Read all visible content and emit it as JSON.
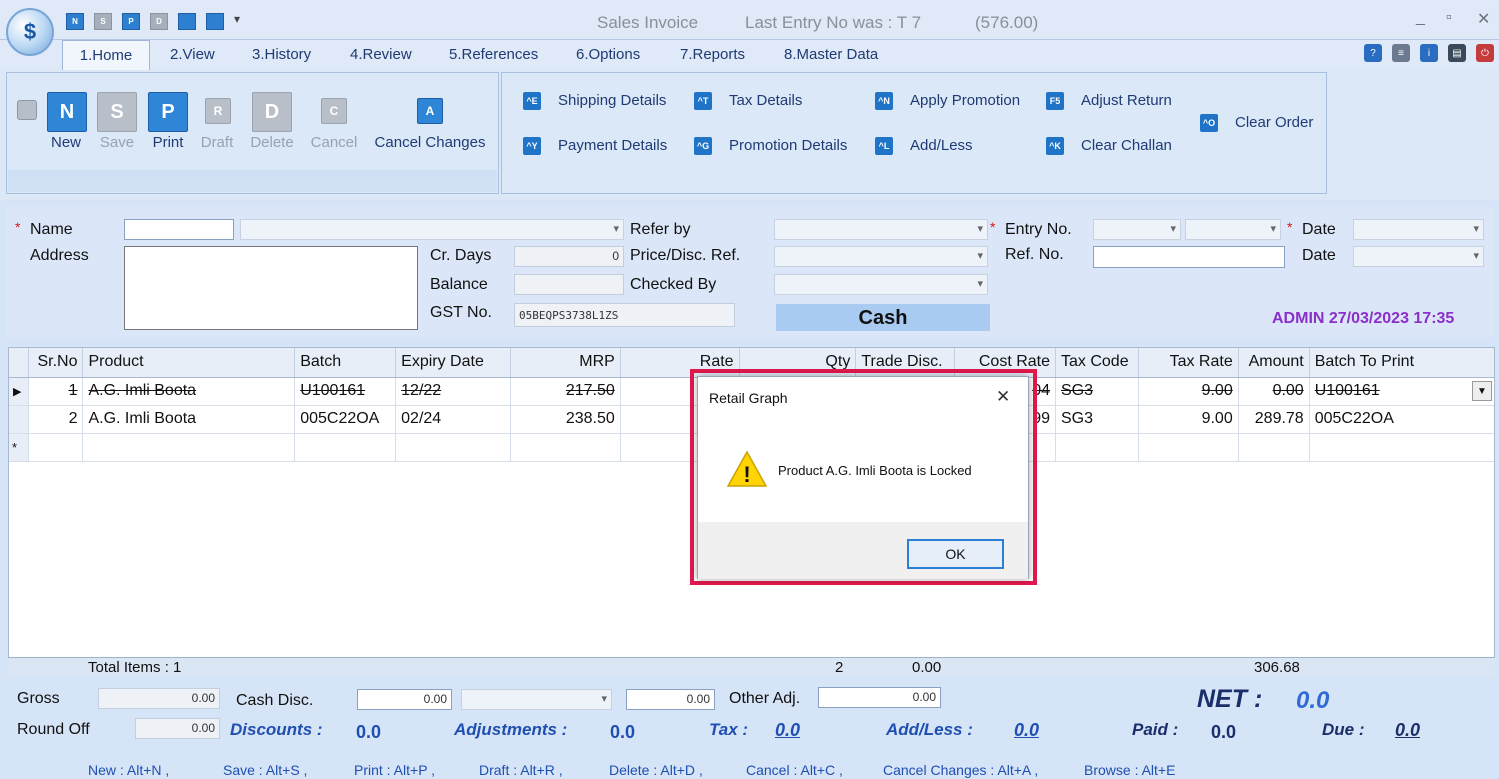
{
  "window": {
    "title": "Sales Invoice",
    "last_entry": "Last Entry No was : T 7",
    "last_amount": "(576.00)",
    "minimize": "_",
    "maximize": "▫",
    "close": "✕"
  },
  "quick_access": [
    "N",
    "S",
    "P",
    "D",
    "",
    "",
    ""
  ],
  "tabs": [
    "1.Home",
    "2.View",
    "3.History",
    "4.Review",
    "5.References",
    "6.Options",
    "7.Reports",
    "8.Master Data"
  ],
  "ribbon": {
    "buttons": [
      {
        "icon": "N",
        "label": "New",
        "enabled": true
      },
      {
        "icon": "S",
        "label": "Save",
        "enabled": false
      },
      {
        "icon": "P",
        "label": "Print",
        "enabled": true
      },
      {
        "icon": "R",
        "label": "Draft",
        "enabled": false
      },
      {
        "icon": "D",
        "label": "Delete",
        "enabled": false
      },
      {
        "icon": "C",
        "label": "Cancel",
        "enabled": false
      },
      {
        "icon": "A",
        "label": "Cancel Changes",
        "enabled": true
      }
    ],
    "links": [
      {
        "icon": "^E",
        "label": "Shipping Details"
      },
      {
        "icon": "^T",
        "label": "Tax Details"
      },
      {
        "icon": "^N",
        "label": "Apply Promotion"
      },
      {
        "icon": "F5",
        "label": "Adjust Return"
      },
      {
        "icon": "^O",
        "label": "Clear Order"
      },
      {
        "icon": "^Y",
        "label": "Payment Details"
      },
      {
        "icon": "^G",
        "label": "Promotion Details"
      },
      {
        "icon": "^L",
        "label": "Add/Less"
      },
      {
        "icon": "^K",
        "label": "Clear Challan"
      }
    ]
  },
  "form": {
    "name_label": "Name",
    "address_label": "Address",
    "cr_days_label": "Cr. Days",
    "cr_days_value": "0",
    "balance_label": "Balance",
    "gst_label": "GST No.",
    "gst_value": "05BEQPS3738L1ZS",
    "refer_by_label": "Refer by",
    "price_disc_label": "Price/Disc. Ref.",
    "checked_by_label": "Checked By",
    "entry_no_label": "Entry No.",
    "ref_no_label": "Ref. No.",
    "date_label": "Date",
    "date2_label": "Date",
    "mode": "Cash",
    "user_stamp": "ADMIN 27/03/2023 17:35"
  },
  "grid": {
    "columns": [
      "Sr.No",
      "Product",
      "Batch",
      "Expiry Date",
      "MRP",
      "Rate",
      "Qty",
      "Trade Disc.",
      "Cost Rate",
      "Tax Code",
      "Tax Rate",
      "Amount",
      "Batch To Print"
    ],
    "rows": [
      {
        "srno": "1",
        "product": "A.G. Imli Boota",
        "batch": "U100161",
        "expiry": "12/22",
        "mrp": "217.50",
        "rate": "1",
        "qty": "",
        "trade": "",
        "cost": "04",
        "taxcode": "SG3",
        "taxrate": "9.00",
        "amount": "0.00",
        "btp": "U100161"
      },
      {
        "srno": "2",
        "product": "A.G. Imli Boota",
        "batch": "005C22OA",
        "expiry": "02/24",
        "mrp": "238.50",
        "rate": "1",
        "qty": "",
        "trade": "",
        "cost": "99",
        "taxcode": "SG3",
        "taxrate": "9.00",
        "amount": "289.78",
        "btp": "005C22OA"
      }
    ],
    "total_items": "Total Items : 1",
    "total_qty": "2",
    "total_trade": "0.00",
    "total_amount": "306.68"
  },
  "summary": {
    "gross_label": "Gross",
    "gross_value": "0.00",
    "cash_disc_label": "Cash Disc.",
    "cash_disc_value": "0.00",
    "cash_disc_value2": "0.00",
    "other_adj_label": "Other Adj.",
    "other_adj_value": "0.00",
    "round_off_label": "Round Off",
    "round_off_value": "0.00",
    "discounts_label": "Discounts :",
    "discounts_value": "0.0",
    "adjustments_label": "Adjustments :",
    "adjustments_value": "0.0",
    "tax_label": "Tax :",
    "tax_value": "0.0",
    "addless_label": "Add/Less :",
    "addless_value": "0.0",
    "paid_label": "Paid :",
    "paid_value": "0.0",
    "due_label": "Due :",
    "due_value": "0.0",
    "net_label": "NET :",
    "net_value": "0.0"
  },
  "shortcuts": [
    "New : Alt+N ,",
    "Save : Alt+S ,",
    "Print : Alt+P ,",
    "Draft : Alt+R ,",
    "Delete : Alt+D ,",
    "Cancel : Alt+C ,",
    "Cancel Changes : Alt+A ,",
    "Browse : Alt+E"
  ],
  "dialog": {
    "title": "Retail Graph",
    "message": "Product A.G. Imli Boota  is Locked",
    "ok": "OK",
    "close": "✕",
    "warning_glyph": "!"
  },
  "colors": {
    "accent": "#2f86d6",
    "dialog_highlight": "#e3184f",
    "user_stamp": "#8b2fc9"
  }
}
